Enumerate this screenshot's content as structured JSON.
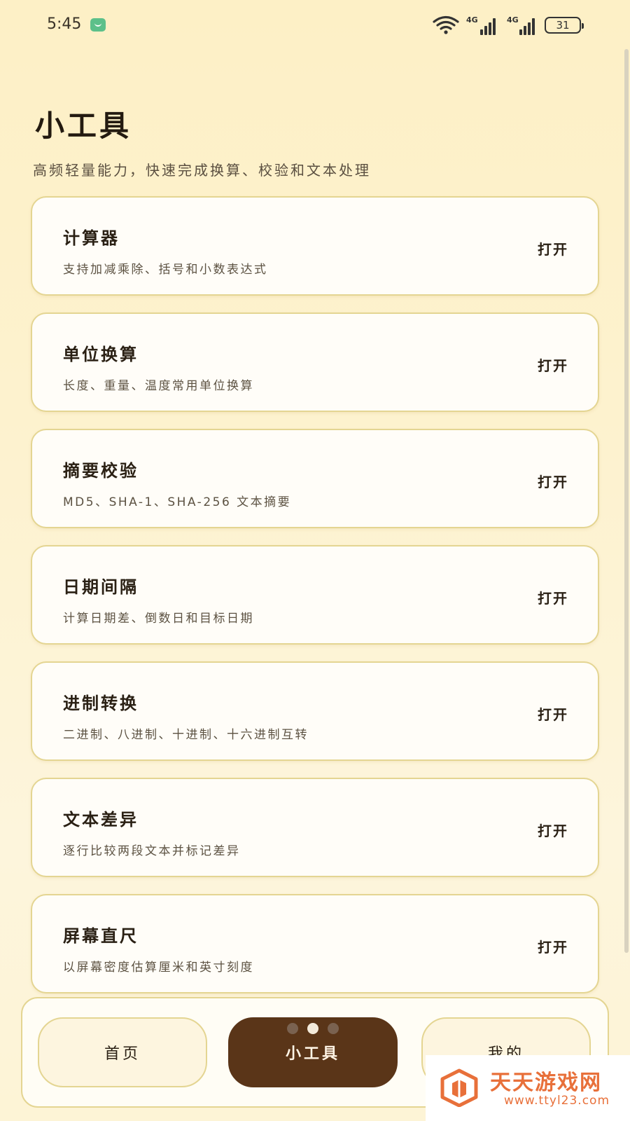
{
  "status_bar": {
    "time": "5:45",
    "network_1": "4G",
    "network_2": "4G",
    "battery": "31"
  },
  "header": {
    "title": "小工具",
    "subtitle": "高频轻量能力，快速完成换算、校验和文本处理"
  },
  "tools": [
    {
      "title": "计算器",
      "desc": "支持加减乘除、括号和小数表达式",
      "action": "打开"
    },
    {
      "title": "单位换算",
      "desc": "长度、重量、温度常用单位换算",
      "action": "打开"
    },
    {
      "title": "摘要校验",
      "desc": "MD5、SHA-1、SHA-256 文本摘要",
      "action": "打开"
    },
    {
      "title": "日期间隔",
      "desc": "计算日期差、倒数日和目标日期",
      "action": "打开"
    },
    {
      "title": "进制转换",
      "desc": "二进制、八进制、十进制、十六进制互转",
      "action": "打开"
    },
    {
      "title": "文本差异",
      "desc": "逐行比较两段文本并标记差异",
      "action": "打开"
    },
    {
      "title": "屏幕直尺",
      "desc": "以屏幕密度估算厘米和英寸刻度",
      "action": "打开"
    }
  ],
  "tab_bar": {
    "tabs": [
      {
        "label": "首页",
        "active": false
      },
      {
        "label": "小工具",
        "active": true
      },
      {
        "label": "我的",
        "active": false
      }
    ],
    "page_indicator": {
      "count": 3,
      "current": 2
    }
  },
  "watermark": {
    "name": "天天游戏网",
    "url": "www.ttyl23.com"
  },
  "colors": {
    "accent": "#5a3518",
    "card_border": "#e4d592",
    "background": "#fdf2cf",
    "watermark": "#e8703a"
  },
  "icons": [
    "message-icon",
    "wifi-icon",
    "signal-icon",
    "battery-icon",
    "watermark-logo-icon"
  ]
}
